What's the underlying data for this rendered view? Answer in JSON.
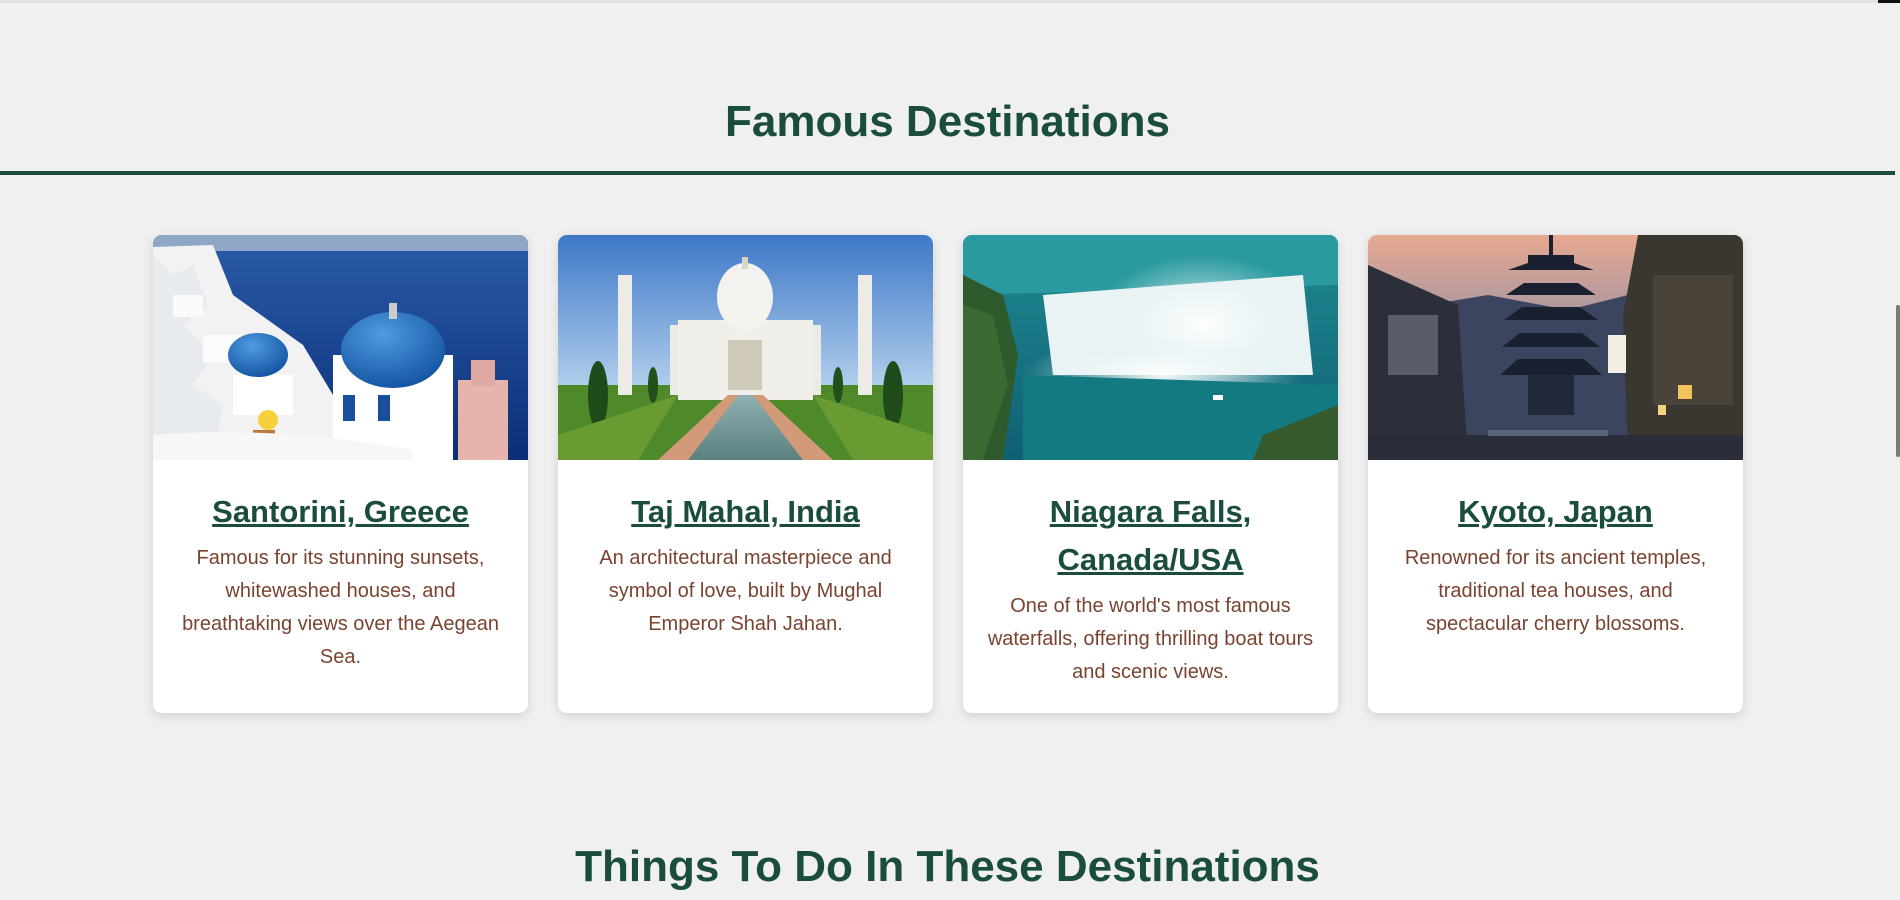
{
  "sections": {
    "famous_title": "Famous Destinations",
    "things_title": "Things To Do In These Destinations"
  },
  "destinations": [
    {
      "title": "Santorini, Greece",
      "description": "Famous for its stunning sunsets, whitewashed houses, and breathtaking views over the Aegean Sea.",
      "image": "santorini-photo"
    },
    {
      "title": "Taj Mahal, India",
      "description": "An architectural masterpiece and symbol of love, built by Mughal Emperor Shah Jahan.",
      "image": "taj-mahal-photo"
    },
    {
      "title": "Niagara Falls, Canada/USA",
      "description": "One of the world's most famous waterfalls, offering thrilling boat tours and scenic views.",
      "image": "niagara-falls-photo"
    },
    {
      "title": "Kyoto, Japan",
      "description": "Renowned for its ancient temples, traditional tea houses, and spectacular cherry blossoms.",
      "image": "kyoto-photo"
    }
  ],
  "colors": {
    "heading": "#1b4d3e",
    "description": "#7a4330",
    "background": "#f0f0f0",
    "card": "#ffffff"
  }
}
